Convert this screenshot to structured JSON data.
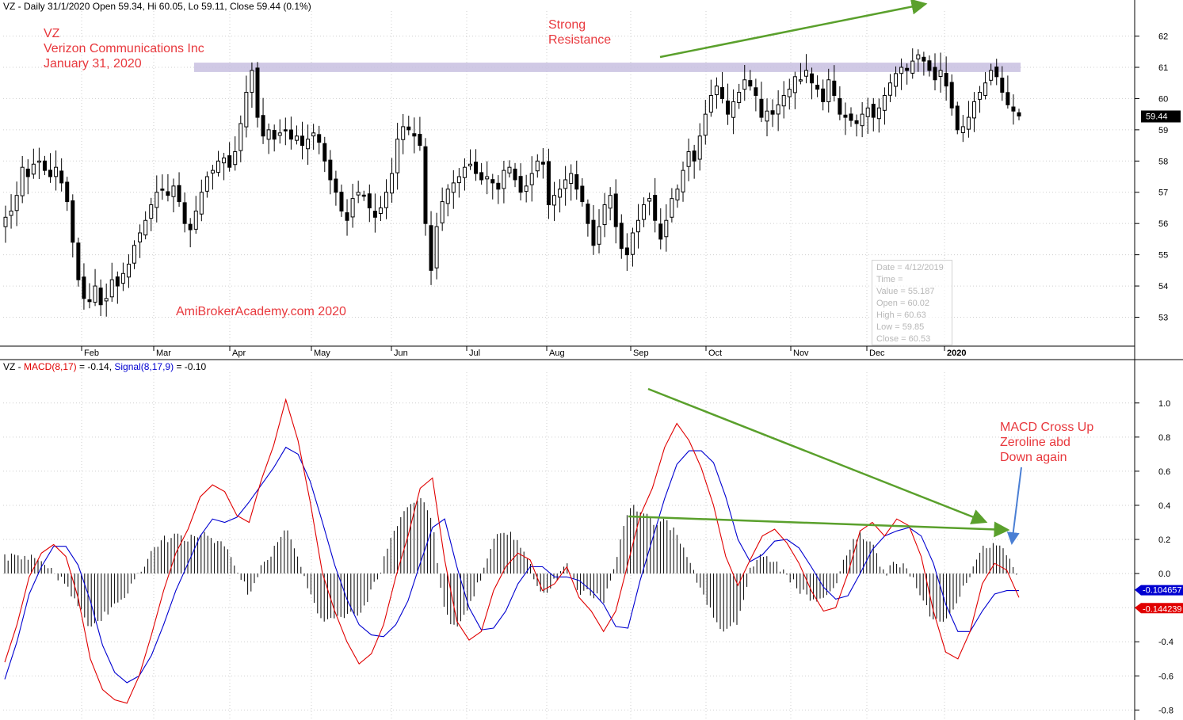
{
  "price_header": {
    "symbol": "VZ",
    "text": " - Daily 31/1/2020 Open 59.34, Hi 60.05, Lo 59.11, Close 59.44 (0.1%)"
  },
  "macd_header": {
    "prefix": "VZ - ",
    "macd_label": "MACD(8,17)",
    "macd_value": " = -0.14, ",
    "signal_label": "Signal(8,17,9)",
    "signal_value": " = -0.10"
  },
  "annotations": {
    "title_lines": [
      "VZ",
      "Verizon Communications Inc",
      "January 31, 2020"
    ],
    "resistance_lines": [
      "Strong",
      "Resistance"
    ],
    "site": "AmiBrokerAcademy.com   2020",
    "macd_lines": [
      "MACD Cross Up",
      "Zeroline abd",
      "Down again"
    ]
  },
  "tooltip": {
    "lines": [
      "Date = 4/12/2019",
      "Time =",
      "Value = 55.187",
      "Open = 60.02",
      "High = 60.63",
      "Low = 59.85",
      "Close = 60.53"
    ]
  },
  "colors": {
    "macd": "#e00000",
    "signal": "#0000d0",
    "candle": "#000000",
    "trendline": "#5aa02c",
    "resistance_band": "#c8c0e0",
    "grid": "#cfcfcf",
    "macd_arrow": "#4a7fd4"
  },
  "chart_data": [
    {
      "type": "candlestick",
      "title": "VZ - Daily 31/1/2020",
      "x_tick_labels": [
        "Feb",
        "Mar",
        "Apr",
        "May",
        "Jun",
        "Jul",
        "Aug",
        "Sep",
        "Oct",
        "Nov",
        "Dec",
        "2020"
      ],
      "y_tick_labels": [
        "53",
        "54",
        "55",
        "56",
        "57",
        "58",
        "59",
        "60",
        "61",
        "62"
      ],
      "ylim": [
        52.1,
        62.8
      ],
      "last_close_label": "59.44",
      "last_close": 59.44,
      "resistance_band": [
        60.85,
        61.15
      ],
      "closes": [
        56.2,
        56.4,
        56.9,
        57.8,
        57.5,
        57.9,
        58.0,
        57.7,
        57.5,
        57.8,
        57.3,
        56.7,
        55.4,
        54.2,
        53.6,
        53.5,
        54.0,
        53.4,
        53.6,
        54.2,
        54.0,
        54.4,
        54.7,
        55.3,
        55.7,
        56.1,
        56.6,
        57.0,
        57.1,
        56.9,
        57.2,
        56.7,
        56.0,
        55.8,
        56.4,
        57.0,
        57.5,
        57.7,
        58.0,
        58.1,
        57.8,
        58.3,
        59.2,
        60.2,
        60.9,
        59.4,
        58.8,
        59.0,
        58.7,
        58.9,
        59.0,
        58.7,
        58.8,
        58.5,
        58.7,
        58.9,
        58.6,
        58.0,
        57.4,
        57.0,
        56.4,
        56.1,
        56.8,
        57.0,
        56.9,
        56.5,
        56.2,
        56.5,
        57.0,
        57.6,
        58.7,
        59.1,
        59.0,
        58.8,
        58.5,
        56.0,
        54.5,
        55.9,
        56.7,
        57.1,
        57.3,
        57.5,
        57.8,
        57.9,
        57.6,
        57.4,
        57.5,
        57.3,
        57.1,
        57.7,
        57.8,
        57.4,
        57.0,
        57.2,
        57.6,
        58.0,
        57.9,
        56.6,
        56.9,
        57.1,
        57.4,
        57.6,
        57.1,
        56.7,
        56.0,
        55.3,
        55.9,
        56.6,
        56.9,
        55.9,
        55.2,
        55.0,
        55.7,
        56.1,
        56.6,
        56.8,
        56.1,
        55.5,
        56.1,
        56.8,
        57.1,
        57.7,
        58.3,
        58.0,
        58.8,
        59.5,
        60.1,
        60.4,
        60.0,
        59.5,
        59.9,
        60.2,
        60.6,
        60.4,
        60.1,
        59.4,
        59.6,
        59.5,
        59.8,
        60.1,
        60.3,
        60.7,
        60.6,
        60.9,
        60.5,
        60.3,
        59.9,
        60.6,
        60.1,
        59.5,
        59.4,
        59.3,
        59.2,
        59.5,
        59.7,
        59.4,
        59.7,
        60.1,
        60.5,
        60.8,
        61.0,
        60.9,
        61.2,
        61.4,
        61.2,
        60.9,
        60.6,
        60.9,
        60.4,
        59.7,
        59.0,
        59.1,
        59.4,
        59.9,
        60.2,
        60.5,
        60.9,
        60.7,
        60.2,
        59.8,
        59.6,
        59.44
      ]
    },
    {
      "type": "line",
      "title": "VZ - MACD(8,17) = -0.14, Signal(8,17,9) = -0.10",
      "y_tick_labels": [
        "1.0",
        "0.8",
        "0.6",
        "0.4",
        "0.2",
        "0.0",
        "-0.2",
        "-0.4",
        "-0.6",
        "-0.8"
      ],
      "ylim": [
        -0.84,
        1.18
      ],
      "series": [
        {
          "name": "MACD(8,17)",
          "values": [
            -0.52,
            -0.3,
            -0.02,
            0.12,
            0.17,
            0.1,
            -0.14,
            -0.5,
            -0.68,
            -0.74,
            -0.76,
            -0.6,
            -0.36,
            -0.1,
            0.12,
            0.26,
            0.45,
            0.52,
            0.48,
            0.34,
            0.3,
            0.55,
            0.75,
            1.02,
            0.78,
            0.42,
            0.0,
            -0.22,
            -0.4,
            -0.53,
            -0.47,
            -0.3,
            -0.02,
            0.22,
            0.5,
            0.56,
            0.08,
            -0.28,
            -0.39,
            -0.34,
            -0.1,
            0.04,
            0.12,
            0.08,
            -0.1,
            -0.06,
            0.04,
            -0.14,
            -0.22,
            -0.34,
            -0.22,
            0.06,
            0.34,
            0.5,
            0.74,
            0.88,
            0.78,
            0.62,
            0.4,
            0.1,
            -0.07,
            0.08,
            0.22,
            0.26,
            0.18,
            0.06,
            -0.1,
            -0.22,
            -0.2,
            0.0,
            0.25,
            0.3,
            0.22,
            0.32,
            0.28,
            0.1,
            -0.22,
            -0.46,
            -0.5,
            -0.34,
            -0.06,
            0.06,
            0.02,
            -0.14
          ]
        },
        {
          "name": "Signal(8,17,9)",
          "values": [
            -0.62,
            -0.4,
            -0.12,
            0.04,
            0.16,
            0.16,
            0.05,
            -0.16,
            -0.42,
            -0.58,
            -0.64,
            -0.6,
            -0.48,
            -0.3,
            -0.1,
            0.06,
            0.22,
            0.32,
            0.3,
            0.33,
            0.42,
            0.52,
            0.62,
            0.74,
            0.7,
            0.54,
            0.3,
            0.05,
            -0.15,
            -0.3,
            -0.36,
            -0.37,
            -0.3,
            -0.16,
            0.06,
            0.27,
            0.32,
            0.04,
            -0.2,
            -0.33,
            -0.32,
            -0.22,
            -0.06,
            0.04,
            0.04,
            -0.02,
            -0.02,
            -0.04,
            -0.1,
            -0.18,
            -0.31,
            -0.32,
            -0.04,
            0.2,
            0.44,
            0.64,
            0.72,
            0.72,
            0.65,
            0.45,
            0.2,
            0.07,
            0.11,
            0.19,
            0.2,
            0.15,
            0.04,
            -0.08,
            -0.15,
            -0.13,
            0.0,
            0.14,
            0.22,
            0.25,
            0.27,
            0.22,
            0.06,
            -0.18,
            -0.34,
            -0.34,
            -0.22,
            -0.12,
            -0.1,
            -0.1
          ]
        },
        {
          "name": "Histogram",
          "values": [
            0.1,
            0.1,
            0.1,
            0.08,
            0.01,
            -0.06,
            -0.19,
            -0.34,
            -0.26,
            -0.16,
            -0.12,
            0.0,
            0.12,
            0.2,
            0.22,
            0.2,
            0.23,
            0.2,
            0.18,
            0.01,
            -0.12,
            0.03,
            0.13,
            0.28,
            0.08,
            -0.12,
            -0.3,
            -0.27,
            -0.25,
            -0.23,
            -0.11,
            0.07,
            0.28,
            0.38,
            0.44,
            0.29,
            -0.24,
            -0.32,
            -0.19,
            -0.01,
            0.22,
            0.26,
            0.18,
            0.04,
            -0.14,
            -0.04,
            0.06,
            -0.1,
            -0.12,
            -0.16,
            0.09,
            0.38,
            0.38,
            0.3,
            0.3,
            0.24,
            0.06,
            -0.1,
            -0.25,
            -0.35,
            -0.27,
            0.01,
            0.11,
            0.07,
            -0.02,
            -0.09,
            -0.14,
            -0.14,
            -0.05,
            0.13,
            0.25,
            0.16,
            0.0,
            0.07,
            0.01,
            -0.12,
            -0.28,
            -0.28,
            -0.16,
            0.0,
            0.16,
            0.18,
            0.12,
            -0.04
          ]
        }
      ],
      "last_values": [
        "-0.104657",
        "-0.144239"
      ]
    }
  ]
}
